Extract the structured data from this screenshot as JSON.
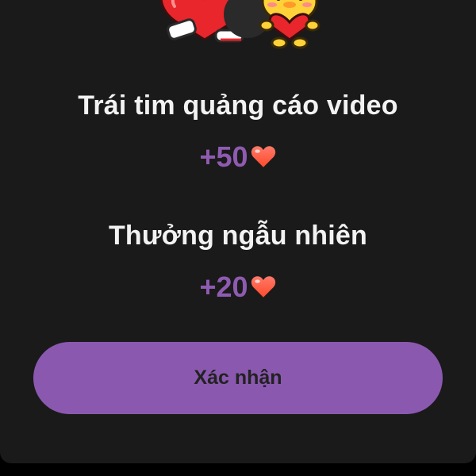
{
  "dialog": {
    "illustration_icon": "heart-couple-sticker-icon",
    "reward_items": [
      {
        "title": "Trái tim quảng cáo video",
        "amount": "+50",
        "icon": "heart-icon"
      },
      {
        "title": "Thưởng ngẫu nhiên",
        "amount": "+20",
        "icon": "heart-icon"
      }
    ],
    "confirm_label": "Xác nhận"
  },
  "colors": {
    "dialog_background": "#1a1a1a",
    "accent": "#8b58b0",
    "title_text": "#f2f2f2",
    "heart": "#ff6b4a"
  }
}
